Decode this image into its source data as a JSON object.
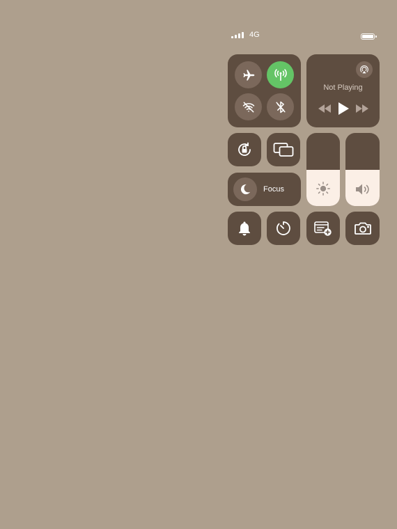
{
  "status_bar": {
    "network": "4G",
    "signal_bars": 4,
    "battery_level": 1.0
  },
  "connectivity": {
    "airplane_mode": false,
    "cellular_data": true,
    "wifi": false,
    "bluetooth": false
  },
  "now_playing": {
    "label": "Not Playing"
  },
  "sliders": {
    "brightness_level": 0.5,
    "volume_level": 0.5
  },
  "focus": {
    "label": "Focus"
  },
  "icons": [
    "airplane-icon",
    "cellular-icon",
    "wifi-off-icon",
    "bluetooth-off-icon",
    "airplay-icon",
    "rewind-icon",
    "play-icon",
    "fast-forward-icon",
    "orientation-lock-icon",
    "screen-mirroring-icon",
    "moon-icon",
    "sun-icon",
    "speaker-icon",
    "bell-icon",
    "timer-icon",
    "note-add-icon",
    "camera-icon"
  ],
  "colors": {
    "background": "#ae9f8d",
    "tile": "#5e4d40",
    "button": "#7b685b",
    "active_green": "#64c466",
    "slider_fill": "#fbefe6"
  }
}
